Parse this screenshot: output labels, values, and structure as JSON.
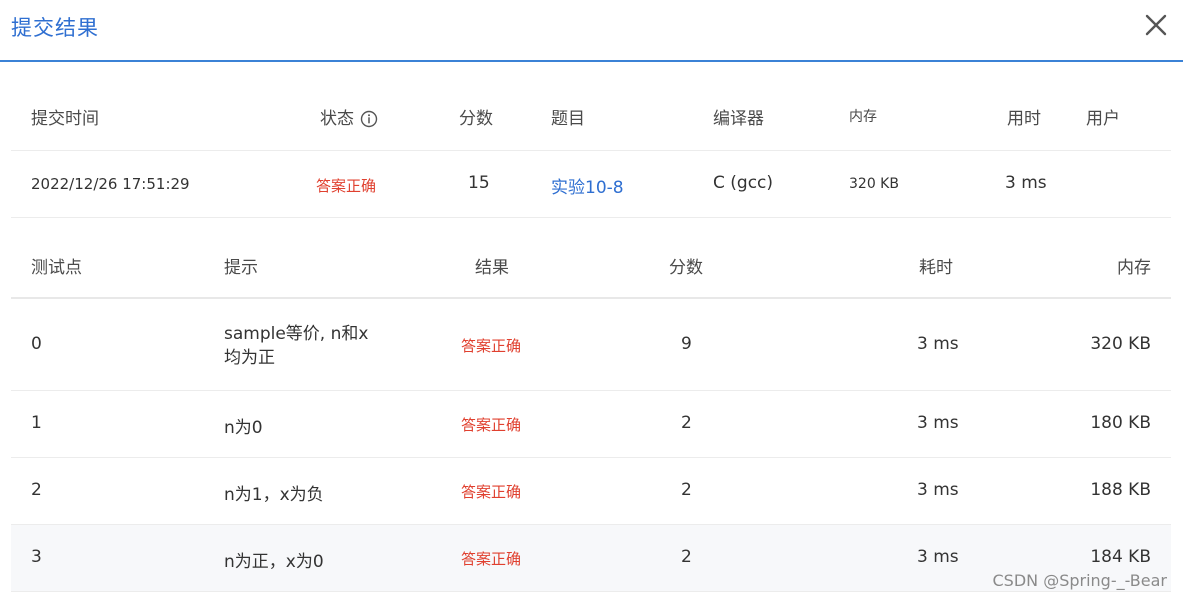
{
  "dialog": {
    "title": "提交结果",
    "close_icon": "close-icon"
  },
  "summary": {
    "headers": {
      "submit_time": "提交时间",
      "status": "状态",
      "score": "分数",
      "problem": "题目",
      "compiler": "编译器",
      "memory": "内存",
      "time_used": "用时",
      "user": "用户"
    },
    "row": {
      "submit_time": "2022/12/26 17:51:29",
      "status": "答案正确",
      "score": "15",
      "problem": "实验10-8",
      "compiler": "C (gcc)",
      "memory": "320 KB",
      "time_used": "3 ms",
      "user": ""
    }
  },
  "tests": {
    "headers": {
      "case": "测试点",
      "hint": "提示",
      "result": "结果",
      "score": "分数",
      "time": "耗时",
      "memory": "内存"
    },
    "rows": [
      {
        "case": "0",
        "hint_line1": "sample等价, n和x",
        "hint_line2": "均为正",
        "result": "答案正确",
        "score": "9",
        "time": "3 ms",
        "memory": "320 KB"
      },
      {
        "case": "1",
        "hint": "n为0",
        "result": "答案正确",
        "score": "2",
        "time": "3 ms",
        "memory": "180 KB"
      },
      {
        "case": "2",
        "hint": "n为1，x为负",
        "result": "答案正确",
        "score": "2",
        "time": "3 ms",
        "memory": "188 KB"
      },
      {
        "case": "3",
        "hint": "n为正，x为0",
        "result": "答案正确",
        "score": "2",
        "time": "3 ms",
        "memory": "184 KB"
      }
    ]
  },
  "watermark": "CSDN @Spring-_-Bear",
  "colors": {
    "accent": "#2f6fd1",
    "success_text": "#e0402f"
  }
}
